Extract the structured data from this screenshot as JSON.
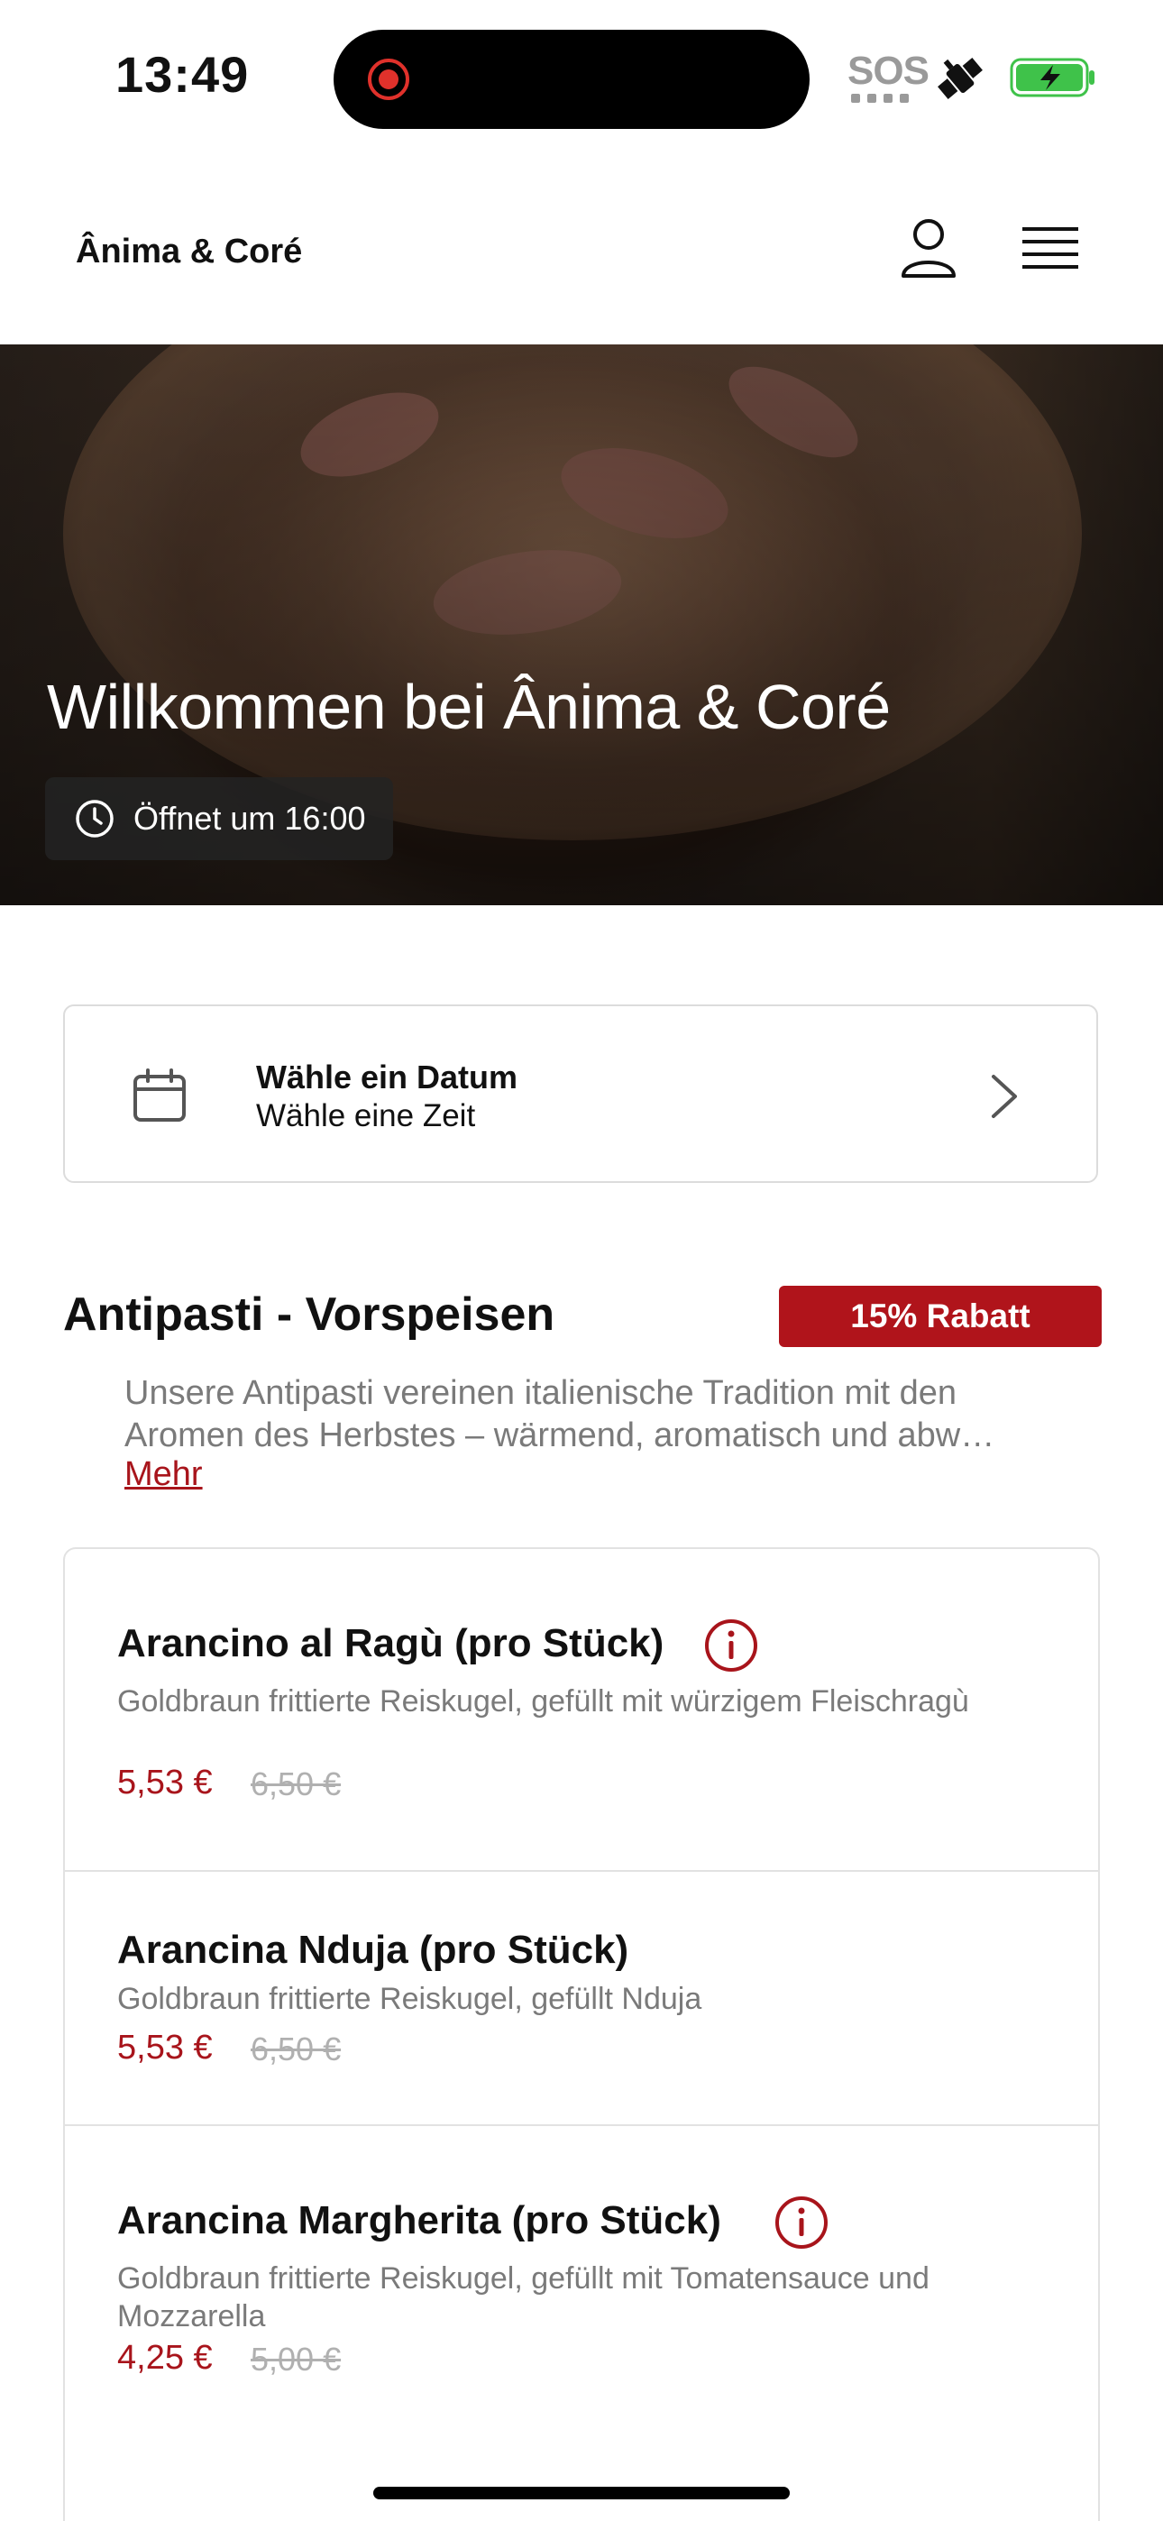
{
  "status_bar": {
    "time": "13:49",
    "sos": "SOS"
  },
  "header": {
    "brand": "Ânima & Coré"
  },
  "hero": {
    "title": "Willkommen bei Ânima & Coré",
    "opening": "Öffnet um 16:00"
  },
  "date_picker": {
    "date_label": "Wähle ein Datum",
    "time_label": "Wähle eine Zeit"
  },
  "section": {
    "title": "Antipasti - Vorspeisen",
    "discount": "15% Rabatt",
    "description_lines": [
      "Unsere Antipasti vereinen italienische Tradition mit den",
      "Aromen des Herbstes – wärmend, aromatisch und abw…"
    ],
    "more": "Mehr"
  },
  "items": [
    {
      "name": "Arancino al Ragù (pro Stück)",
      "description": "Goldbraun frittierte Reiskugel, gefüllt mit würzigem Fleischragù",
      "price": "5,53 €",
      "old_price": "6,50 €"
    },
    {
      "name": "Arancina Nduja (pro Stück)",
      "description": "Goldbraun frittierte Reiskugel, gefüllt Nduja",
      "price": "5,53 €",
      "old_price": "6,50 €"
    },
    {
      "name": "Arancina Margherita (pro Stück)",
      "description": "Goldbraun frittierte Reiskugel, gefüllt mit Tomatensauce und Mozzarella",
      "price": "4,25 €",
      "old_price": "5,00 €"
    }
  ],
  "colors": {
    "accent": "#a8141b",
    "badge": "#b0141b",
    "battery": "#3fc24a"
  },
  "icons": [
    "record-icon",
    "satellite-icon",
    "battery-icon",
    "user-icon",
    "menu-icon",
    "clock-icon",
    "calendar-icon",
    "chevron-right-icon",
    "info-icon"
  ]
}
